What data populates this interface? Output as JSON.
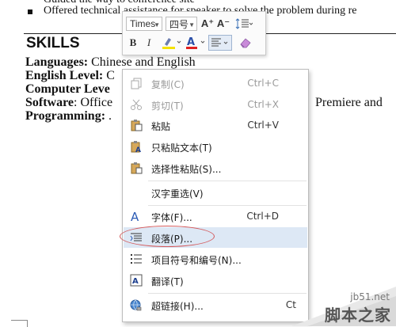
{
  "document": {
    "line1": "Guided the way to conference site",
    "line2": "Offered technical assistance for speaker to solve the problem during re",
    "heading": "SKILLS",
    "rows": [
      {
        "label": "Languages:",
        "value": " Chinese and English",
        "tail": ""
      },
      {
        "label": "English Level:",
        "value": " C",
        "tail": ""
      },
      {
        "label": "Computer Leve",
        "value": "",
        "tail": ""
      },
      {
        "label": "Software",
        "value": ": Office",
        "tail": "Premiere and"
      },
      {
        "label": "Programming:",
        "value": " .",
        "tail": ""
      }
    ]
  },
  "toolbar": {
    "font_name": "Times",
    "font_size": "四号",
    "grow_icon": "A⁺",
    "shrink_icon": "A⁻",
    "bold": "B",
    "italic": "I",
    "font_color": "A"
  },
  "menu": {
    "items": [
      {
        "icon": "copy-icon",
        "label": "复制(C)",
        "shortcut": "Ctrl+C",
        "disabled": true
      },
      {
        "icon": "cut-icon",
        "label": "剪切(T)",
        "shortcut": "Ctrl+X",
        "disabled": true
      },
      {
        "icon": "paste-icon",
        "label": "粘贴",
        "shortcut": "Ctrl+V",
        "disabled": false
      },
      {
        "icon": "paste-text-icon",
        "label": "只粘贴文本(T)",
        "shortcut": "",
        "disabled": false
      },
      {
        "icon": "paste-special-icon",
        "label": "选择性粘贴(S)...",
        "shortcut": "",
        "disabled": false
      },
      {
        "icon": "",
        "label": "汉字重选(V)",
        "shortcut": "",
        "disabled": false
      },
      {
        "icon": "font-icon",
        "label": "字体(F)...",
        "shortcut": "Ctrl+D",
        "disabled": false
      },
      {
        "icon": "paragraph-icon",
        "label": "段落(P)...",
        "shortcut": "",
        "disabled": false
      },
      {
        "icon": "bullets-numbering-icon",
        "label": "项目符号和编号(N)...",
        "shortcut": "",
        "disabled": false
      },
      {
        "icon": "translate-icon",
        "label": "翻译(T)",
        "shortcut": "",
        "disabled": false
      },
      {
        "icon": "hyperlink-icon",
        "label": "超链接(H)...",
        "shortcut": "Ct",
        "disabled": false
      }
    ]
  },
  "watermark": {
    "site": "jb51.net",
    "name": "脚本之家"
  },
  "colors": {
    "highlight": "#dde8f5",
    "annotation_ellipse": "#d4595b",
    "font_color_bar": "#e02020",
    "highlight_bar": "#f5e200"
  }
}
